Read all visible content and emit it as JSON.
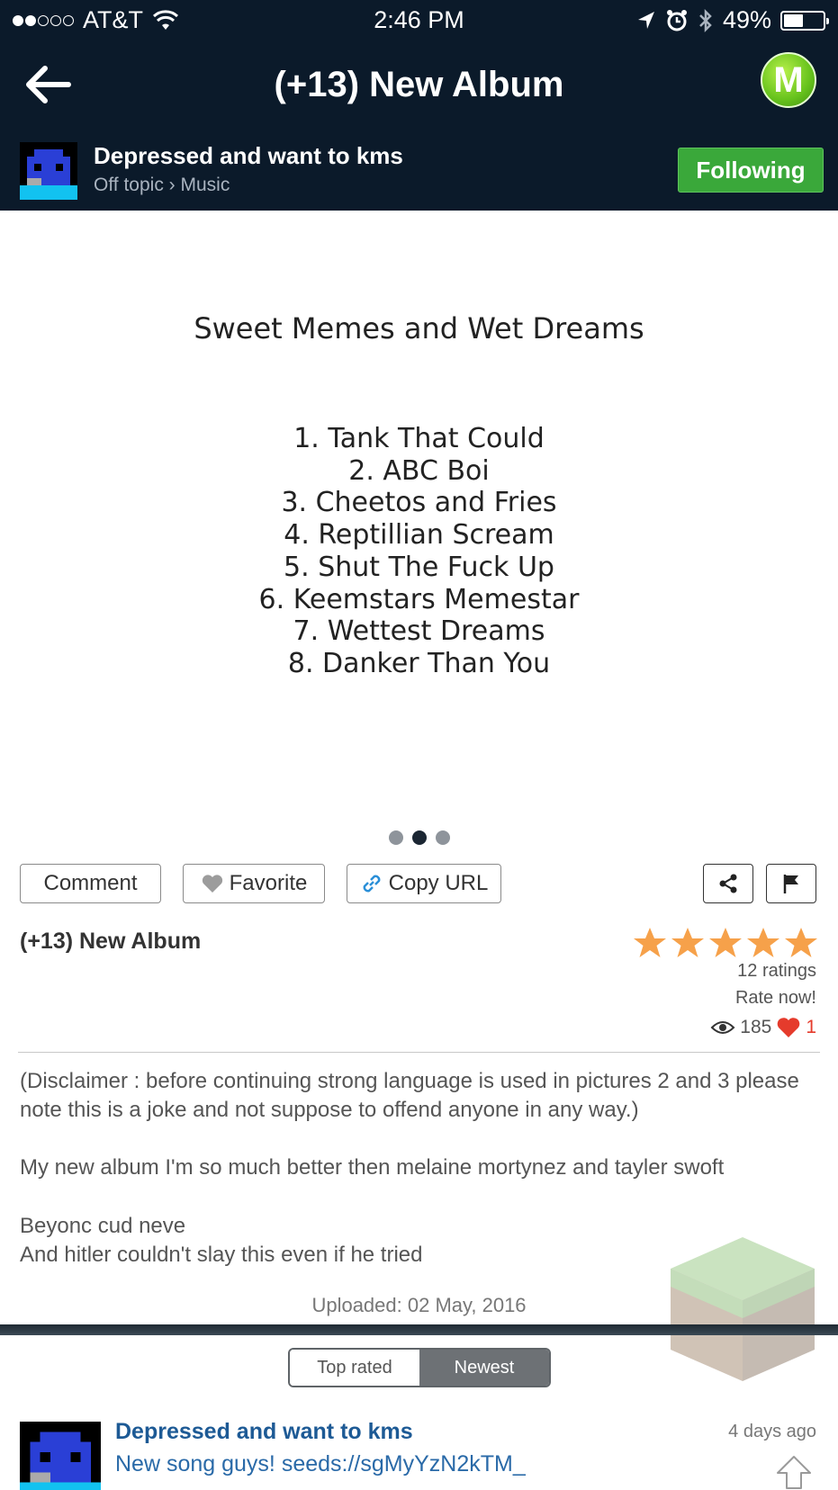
{
  "status_bar": {
    "carrier": "AT&T",
    "time": "2:46 PM",
    "battery": "49%",
    "battery_level": 0.49
  },
  "nav": {
    "title": "(+13) New Album",
    "logo_letter": "M"
  },
  "author": {
    "name": "Depressed and want to kms",
    "breadcrumb": "Off topic › Music",
    "follow_label": "Following"
  },
  "album": {
    "title": "Sweet Memes and Wet Dreams",
    "tracks": [
      "1. Tank That Could",
      "2. ABC Boi",
      "3. Cheetos and Fries",
      "4. Reptillian Scream",
      "5. Shut The Fuck Up",
      "6. Keemstars Memestar",
      "7. Wettest Dreams",
      "8. Danker Than You"
    ],
    "pager_count": 3,
    "pager_active": 1
  },
  "actions": {
    "comment": "Comment",
    "favorite": "Favorite",
    "copy_url": "Copy URL"
  },
  "post": {
    "title": "(+13) New Album",
    "rating": 5,
    "ratings_count": "12 ratings",
    "rate_now": "Rate now!",
    "views": "185",
    "likes": "1",
    "description": [
      "(Disclaimer : before continuing strong language is used in pictures 2 and 3 please note this is a joke and not suppose to offend anyone in any way.)",
      "My new album I'm so much better then melaine mortynez and tayler swoft",
      "Beyonc cud neve\nAnd hitler couldn't slay this even if he tried"
    ],
    "uploaded": "Uploaded: 02 May, 2016"
  },
  "comments": {
    "sort_options": [
      "Top rated",
      "Newest"
    ],
    "sort_selected": "Newest",
    "items": [
      {
        "author": "Depressed and want to kms",
        "text": "New song guys! seeds://sgMyYzN2kTM_",
        "time": "4 days ago"
      }
    ]
  },
  "colors": {
    "header_bg": "#0b1a2a",
    "follow_green": "#3aa83a",
    "star_orange": "#f6a14a",
    "link_blue": "#1d5a95",
    "heart_red": "#e53b2c"
  }
}
